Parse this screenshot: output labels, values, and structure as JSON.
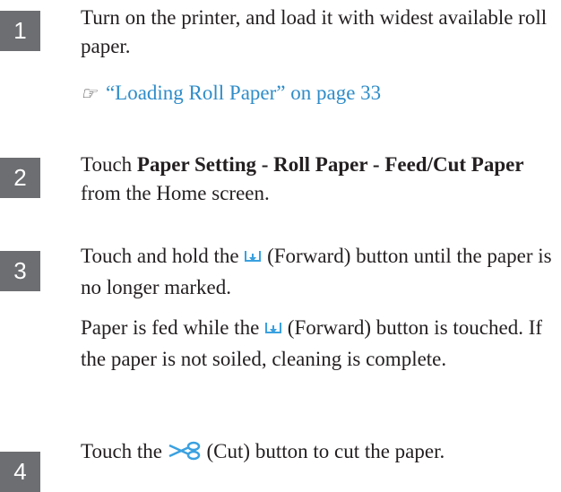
{
  "steps": [
    {
      "number": "1",
      "text": "Turn on the printer, and load it with widest available roll paper.",
      "ref_mark": "☞",
      "link": "“Loading Roll Paper” on page 33"
    },
    {
      "number": "2",
      "prefix": "Touch ",
      "bold1": "Paper Setting",
      "sep1": " - ",
      "bold2": "Roll Paper",
      "sep2": " - ",
      "bold3": "Feed/Cut Paper",
      "suffix": " from the Home screen."
    },
    {
      "number": "3",
      "p1_before": "Touch and hold the ",
      "p1_after": " (Forward) button until the paper is no longer marked.",
      "p2_before": "Paper is fed while the ",
      "p2_after": " (Forward) button is touched. If the paper is not soiled, cleaning is complete.",
      "icon": "forward-icon"
    },
    {
      "number": "4",
      "before": "Touch the ",
      "after": " (Cut) button to cut the paper.",
      "icon": "scissors-icon"
    }
  ]
}
